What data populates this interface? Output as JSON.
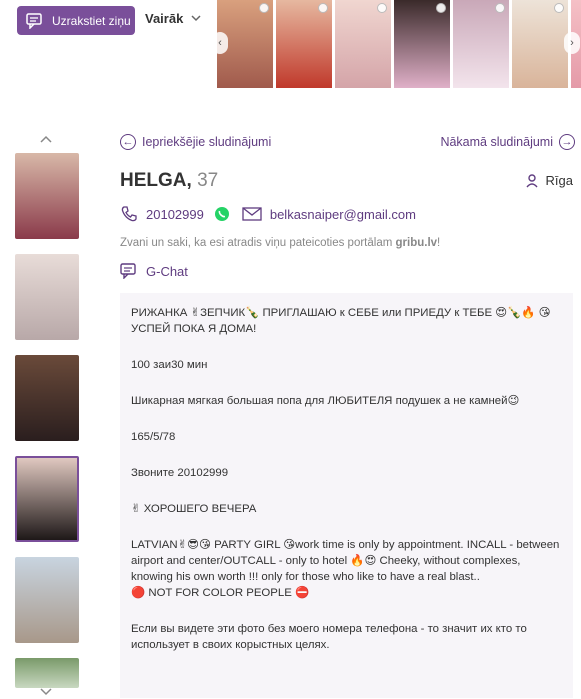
{
  "header": {
    "write_button_label": "Uzrakstiet ziņu",
    "more_label": "Vairāk",
    "top_thumbnails": [
      {
        "badge": "premium-icon",
        "color_top": "#d9a07e",
        "color_bottom": "#a05a4c"
      },
      {
        "badge": "premium-icon",
        "color_top": "#e6b8a0",
        "color_bottom": "#c0392b"
      },
      {
        "badge": "premium-icon",
        "color_top": "#f0d6d0",
        "color_bottom": "#d4a4a8"
      },
      {
        "badge": "premium-icon",
        "color_top": "#3a2a2a",
        "color_bottom": "#e0b0c8"
      },
      {
        "badge": "premium-icon",
        "color_top": "#c9a8b8",
        "color_bottom": "#f3e4ec"
      },
      {
        "badge": "star-icon",
        "color_top": "#ede3d8",
        "color_bottom": "#d9b49a"
      },
      {
        "badge": "premium-icon",
        "color_top": "#f5c0c6",
        "color_bottom": "#e49aa8"
      }
    ]
  },
  "navigation": {
    "prev_label": "Iepriekšējie sludinājumi",
    "next_label": "Nākamā sludinājumi"
  },
  "listing": {
    "name": "HELGA,",
    "age": "37",
    "city": "Rīga",
    "phone": "20102999",
    "email": "belkasnaiper@gmail.com",
    "hint_text": "Zvani un saki, ka esi atradis viņu pateicoties portālam",
    "hint_site": "gribu.lv",
    "hint_end": "!",
    "gchat_label": "G-Chat",
    "description": [
      "РИЖАНКА ✌ЗЕПЧИК🍾 ПРИГЛАШАЮ к СЕБЕ или ПРИЕДУ к ТЕБЕ 😍🍾🔥 😘 УСПЕЙ ПОКА Я ДОМА!",
      "100 заи30 мин",
      "Шикарная мягкая большая попа для ЛЮБИТЕЛЯ подушек а не камней😉",
      "165/5/78",
      "Звоните 20102999",
      "✌ ХОРОШЕГО ВЕЧЕРА",
      "LATVIAN✌😎😘 PARTY GIRL 😘work time is only by appointment. INCALL - between airport and center/OUTCALL - only to hotel 🔥😍 Cheeky, without complexes, knowing his own worth !!! only for those who like to have a real blast..\n🔴 NOT FOR COLOR PEOPLE ⛔",
      "Если вы видете эти фото без моего номера телефона - то значит их кто то использует в своих корыстных целях."
    ]
  },
  "gallery": {
    "thumbs": [
      {
        "color_top": "#d8b8a8",
        "color_bottom": "#8a3a4a"
      },
      {
        "color_top": "#e8dcd8",
        "color_bottom": "#b8a8a8"
      },
      {
        "color_top": "#6a4a3a",
        "color_bottom": "#2a1e1e"
      },
      {
        "color_top": "#e0c8c0",
        "color_bottom": "#1e1818"
      },
      {
        "color_top": "#c8d4e0",
        "color_bottom": "#a8988a"
      },
      {
        "color_top": "#7a9a6a",
        "color_bottom": "#c8d8c0"
      }
    ]
  },
  "colors": {
    "accent": "#7a4f9a",
    "link": "#5f3c80",
    "whatsapp": "#25d366",
    "description_bg": "#f7f5f9"
  }
}
